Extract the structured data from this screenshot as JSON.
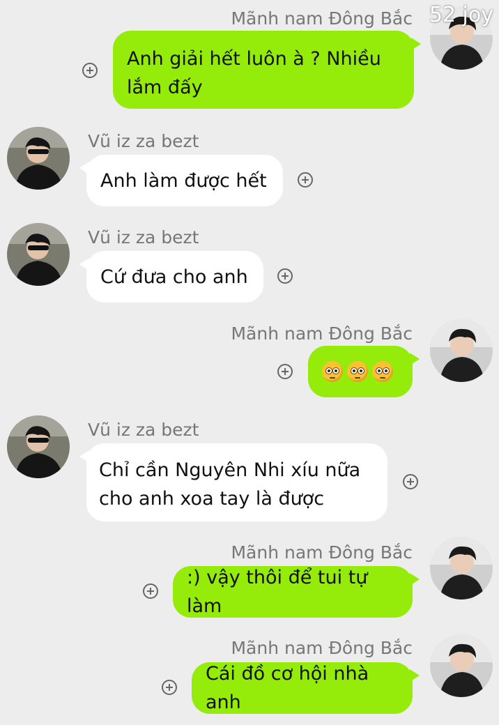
{
  "watermark": "52 joy",
  "messages": [
    {
      "sender": "Mãnh nam Đông Bắc",
      "lines": [
        "Anh giải hết luôn à ? Nhiều",
        "lắm đấy"
      ],
      "side": "right"
    },
    {
      "sender": "Vũ iz za bezt",
      "lines": [
        "Anh làm được hết"
      ],
      "side": "left"
    },
    {
      "sender": "Vũ iz za bezt",
      "lines": [
        "Cứ đưa cho anh"
      ],
      "side": "left"
    },
    {
      "sender": "Mãnh nam Đông Bắc",
      "emoji": [
        "pleading-face",
        "pleading-face",
        "pleading-face"
      ],
      "side": "right"
    },
    {
      "sender": "Vũ iz za bezt",
      "lines": [
        "Chỉ cần Nguyên Nhi xíu nữa",
        "cho anh xoa tay là được"
      ],
      "side": "left"
    },
    {
      "sender": "Mãnh nam Đông Bắc",
      "lines": [
        ":) vậy thôi để tui tự làm"
      ],
      "side": "right"
    },
    {
      "sender": "Mãnh nam Đông Bắc",
      "lines": [
        "Cái đồ cơ hội nhà anh"
      ],
      "side": "right"
    }
  ],
  "colors": {
    "outgoing_bubble": "#95ec0a",
    "incoming_bubble": "#ffffff",
    "background": "#ededed"
  },
  "icons": {
    "reaction": "plus-circle-icon",
    "avatar_right": "avatar-manh-nam-dong-bac",
    "avatar_left": "avatar-vu-iz-za-bezt"
  }
}
